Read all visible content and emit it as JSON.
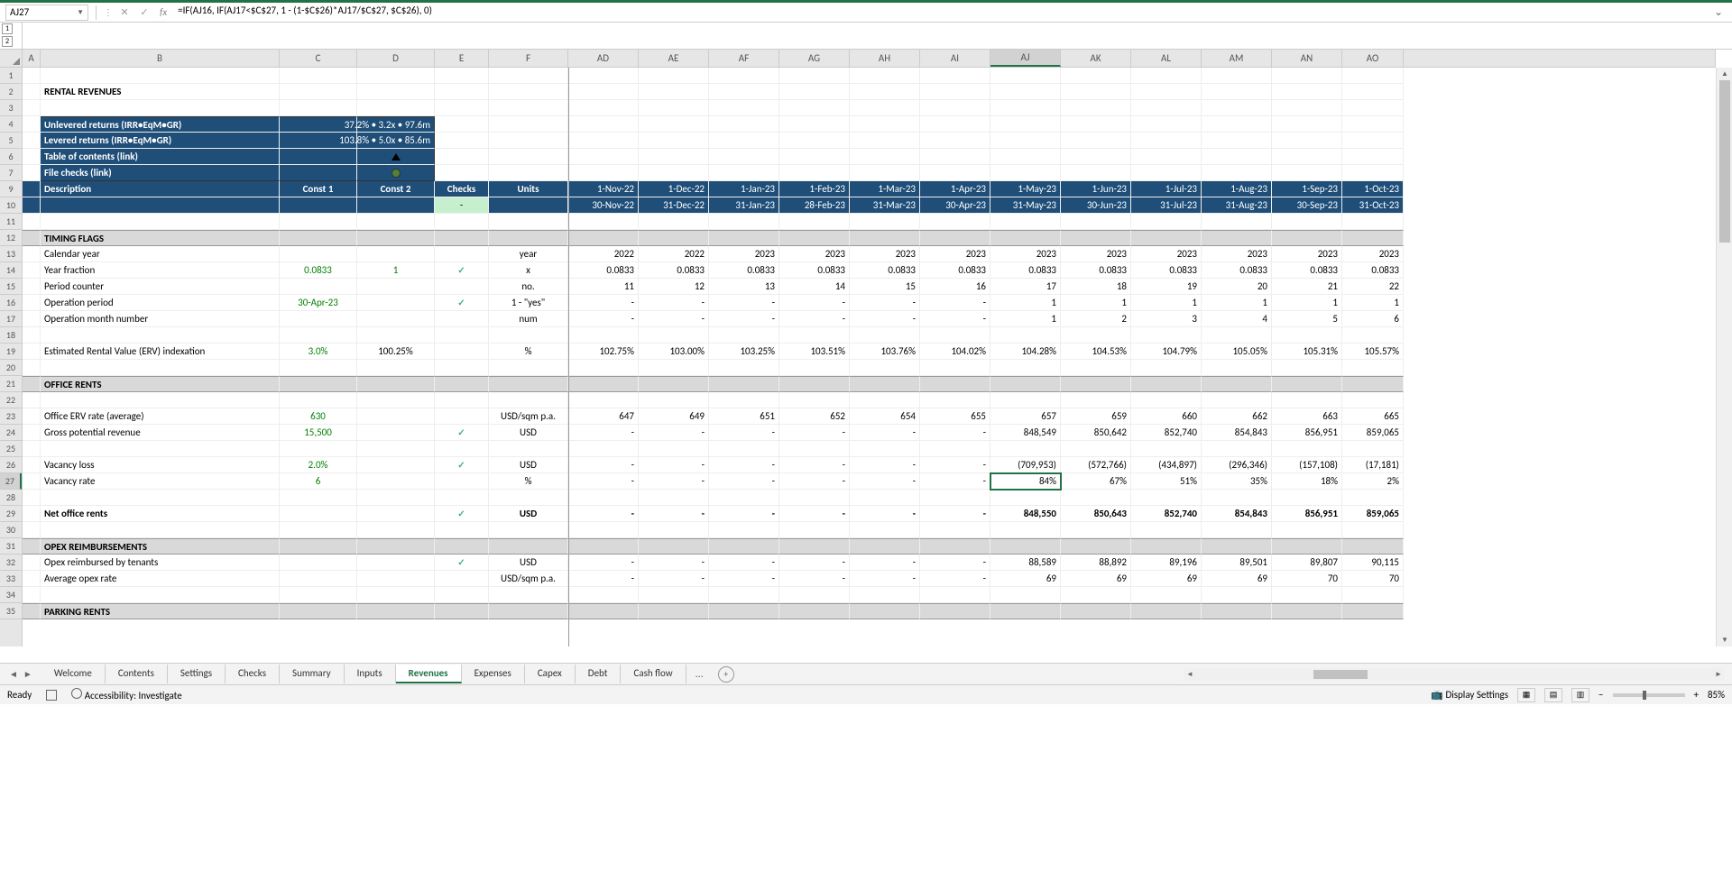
{
  "nameBox": "AJ27",
  "formula": "=IF(AJ16, IF(AJ17<$C$27, 1 - (1-$C$26)*AJ17/$C$27, $C$26), 0)",
  "cols": {
    "A": 20,
    "B": 265,
    "C": 86,
    "D": 86,
    "E": 60,
    "F": 88,
    "AD": 78,
    "AE": 78,
    "AF": 78,
    "AG": 78,
    "AH": 78,
    "AI": 78,
    "AJ": 78,
    "AK": 78,
    "AL": 78,
    "AM": 78,
    "AN": 78,
    "AO": 68
  },
  "colOrder": [
    "A",
    "B",
    "C",
    "D",
    "E",
    "F",
    "AD",
    "AE",
    "AF",
    "AG",
    "AH",
    "AI",
    "AJ",
    "AK",
    "AL",
    "AM",
    "AN",
    "AO"
  ],
  "selectedCol": "AJ",
  "selectedRow": 27,
  "rows": [
    1,
    2,
    3,
    4,
    5,
    6,
    7,
    9,
    10,
    11,
    12,
    13,
    14,
    15,
    16,
    17,
    18,
    19,
    20,
    21,
    22,
    23,
    24,
    25,
    26,
    27,
    28,
    29,
    30,
    31,
    32,
    33,
    34,
    35
  ],
  "title": "RENTAL REVENUES",
  "summaryBox": {
    "row4": {
      "label": "Unlevered returns (IRR•EqM•GR)",
      "val": "37.2% • 3.2x • 97.6m"
    },
    "row5": {
      "label": "Levered returns (IRR•EqM•GR)",
      "val": "103.8% • 5.0x • 85.6m"
    },
    "row6": {
      "label": "Table of contents (link)"
    },
    "row7": {
      "label": "File checks (link)"
    }
  },
  "headers": {
    "description": "Description",
    "const1": "Const 1",
    "const2": "Const 2",
    "checks": "Checks",
    "units": "Units",
    "checkVal": "-",
    "dates1": [
      "1-Nov-22",
      "1-Dec-22",
      "1-Jan-23",
      "1-Feb-23",
      "1-Mar-23",
      "1-Apr-23",
      "1-May-23",
      "1-Jun-23",
      "1-Jul-23",
      "1-Aug-23",
      "1-Sep-23",
      "1-Oct-23"
    ],
    "dates2": [
      "30-Nov-22",
      "31-Dec-22",
      "31-Jan-23",
      "28-Feb-23",
      "31-Mar-23",
      "30-Apr-23",
      "31-May-23",
      "30-Jun-23",
      "31-Jul-23",
      "31-Aug-23",
      "30-Sep-23",
      "31-Oct-23"
    ]
  },
  "sections": {
    "timing": "TIMING FLAGS",
    "office": "OFFICE RENTS",
    "opex": "OPEX REIMBURSEMENTS",
    "parking": "PARKING RENTS"
  },
  "rows_data": {
    "13": {
      "desc": "Calendar year",
      "unit": "year",
      "vals": [
        "2022",
        "2022",
        "2023",
        "2023",
        "2023",
        "2023",
        "2023",
        "2023",
        "2023",
        "2023",
        "2023",
        "2023"
      ]
    },
    "14": {
      "desc": "Year fraction",
      "c1": "0.0833",
      "c2": "1",
      "check": true,
      "unit": "x",
      "vals": [
        "0.0833",
        "0.0833",
        "0.0833",
        "0.0833",
        "0.0833",
        "0.0833",
        "0.0833",
        "0.0833",
        "0.0833",
        "0.0833",
        "0.0833",
        "0.0833"
      ]
    },
    "15": {
      "desc": "Period counter",
      "unit": "no.",
      "vals": [
        "11",
        "12",
        "13",
        "14",
        "15",
        "16",
        "17",
        "18",
        "19",
        "20",
        "21",
        "22"
      ]
    },
    "16": {
      "desc": "Operation period",
      "c1": "30-Apr-23",
      "check": true,
      "unit": "1 - \"yes\"",
      "vals": [
        "-",
        "-",
        "-",
        "-",
        "-",
        "-",
        "1",
        "1",
        "1",
        "1",
        "1",
        "1"
      ]
    },
    "17": {
      "desc": "Operation month number",
      "unit": "num",
      "vals": [
        "-",
        "-",
        "-",
        "-",
        "-",
        "-",
        "1",
        "2",
        "3",
        "4",
        "5",
        "6"
      ]
    },
    "19": {
      "desc": "Estimated Rental Value (ERV) indexation",
      "c1": "3.0%",
      "c2": "100.25%",
      "unit": "%",
      "vals": [
        "102.75%",
        "103.00%",
        "103.25%",
        "103.51%",
        "103.76%",
        "104.02%",
        "104.28%",
        "104.53%",
        "104.79%",
        "105.05%",
        "105.31%",
        "105.57%"
      ]
    },
    "23": {
      "desc": "Office ERV rate (average)",
      "c1": "630",
      "unit": "USD/sqm p.a.",
      "vals": [
        "647",
        "649",
        "651",
        "652",
        "654",
        "655",
        "657",
        "659",
        "660",
        "662",
        "663",
        "665"
      ]
    },
    "24": {
      "desc": "Gross potential revenue",
      "c1": "15,500",
      "check": true,
      "unit": "USD",
      "vals": [
        "-",
        "-",
        "-",
        "-",
        "-",
        "-",
        "848,549",
        "850,642",
        "852,740",
        "854,843",
        "856,951",
        "859,065"
      ]
    },
    "26": {
      "desc": "Vacancy loss",
      "c1": "2.0%",
      "check": true,
      "unit": "USD",
      "vals": [
        "-",
        "-",
        "-",
        "-",
        "-",
        "-",
        "(709,953)",
        "(572,766)",
        "(434,897)",
        "(296,346)",
        "(157,108)",
        "(17,181)"
      ]
    },
    "27": {
      "desc": "Vacancy rate",
      "c1": "6",
      "unit": "%",
      "vals": [
        "-",
        "-",
        "-",
        "-",
        "-",
        "-",
        "84%",
        "67%",
        "51%",
        "35%",
        "18%",
        "2%"
      ]
    },
    "29": {
      "desc": "Net office rents",
      "check": true,
      "unit": "USD",
      "bold": true,
      "vals": [
        "-",
        "-",
        "-",
        "-",
        "-",
        "-",
        "848,550",
        "850,643",
        "852,740",
        "854,843",
        "856,951",
        "859,065"
      ]
    },
    "32": {
      "desc": "Opex reimbursed by tenants",
      "check": true,
      "unit": "USD",
      "vals": [
        "-",
        "-",
        "-",
        "-",
        "-",
        "-",
        "88,589",
        "88,892",
        "89,196",
        "89,501",
        "89,807",
        "90,115"
      ]
    },
    "33": {
      "desc": "Average opex rate",
      "unit": "USD/sqm p.a.",
      "vals": [
        "-",
        "-",
        "-",
        "-",
        "-",
        "-",
        "69",
        "69",
        "69",
        "69",
        "70",
        "70"
      ]
    }
  },
  "tabs": [
    "Welcome",
    "Contents",
    "Settings",
    "Checks",
    "Summary",
    "Inputs",
    "Revenues",
    "Expenses",
    "Capex",
    "Debt",
    "Cash flow"
  ],
  "activeTab": "Revenues",
  "moreTab": "...",
  "statusBar": {
    "ready": "Ready",
    "accessibility": "Accessibility: Investigate",
    "display": "Display Settings",
    "zoom": "85%"
  }
}
